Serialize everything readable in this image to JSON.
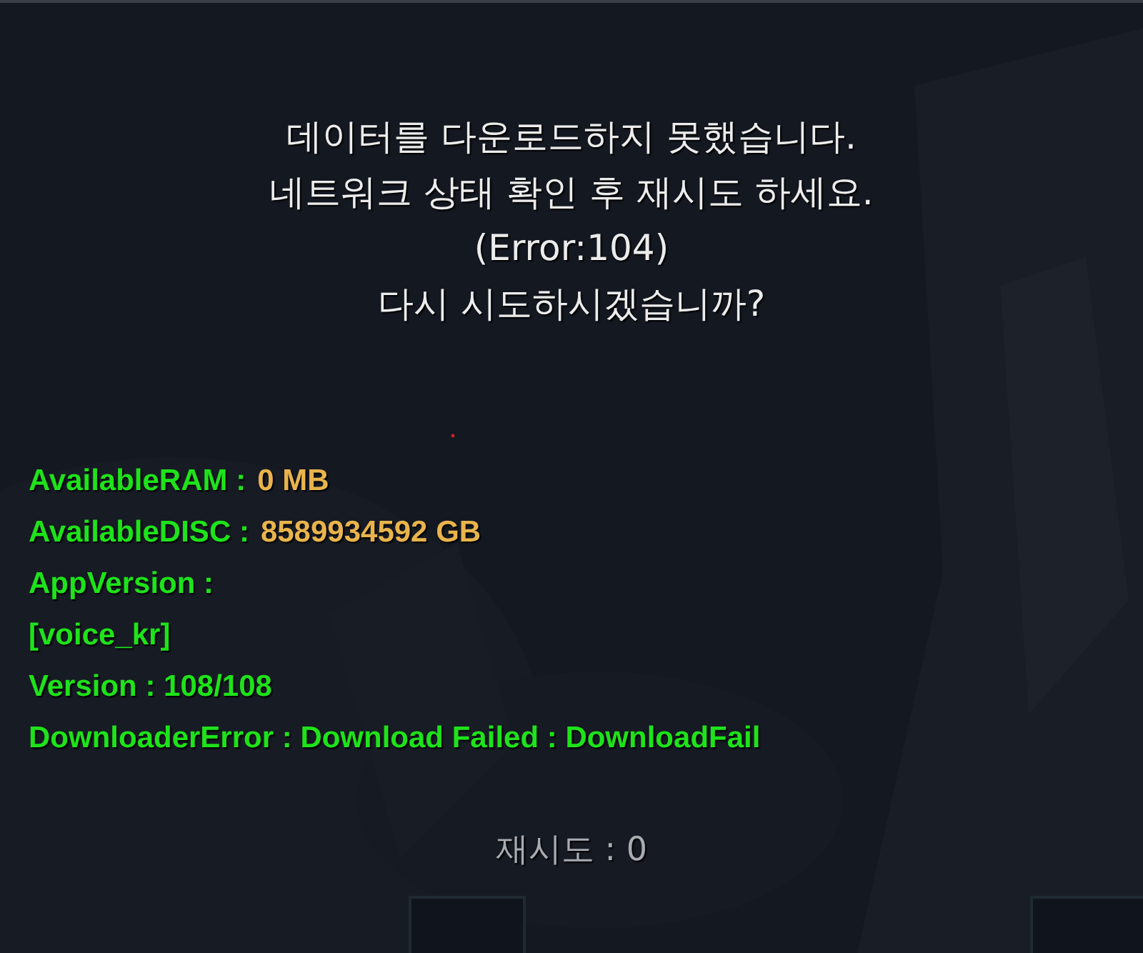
{
  "message": {
    "lines": [
      "데이터를 다운로드하지 못했습니다.",
      "네트워크 상태 확인 후 재시도 하세요.",
      "(Error:104)",
      "다시 시도하시겠습니까?"
    ]
  },
  "info": [
    {
      "label": "AvailableRAM :",
      "value": "0 MB",
      "color": "#e9b44c"
    },
    {
      "label": "AvailableDISC :",
      "value": "8589934592 GB",
      "color": "#e9b44c"
    },
    {
      "label": "AppVersion :"
    },
    {
      "label": "[voice_kr]"
    },
    {
      "label": "Version : 108/108"
    },
    {
      "label": "DownloaderError : Download Failed : DownloadFail"
    }
  ],
  "retry": {
    "text": "재시도 : 0"
  }
}
